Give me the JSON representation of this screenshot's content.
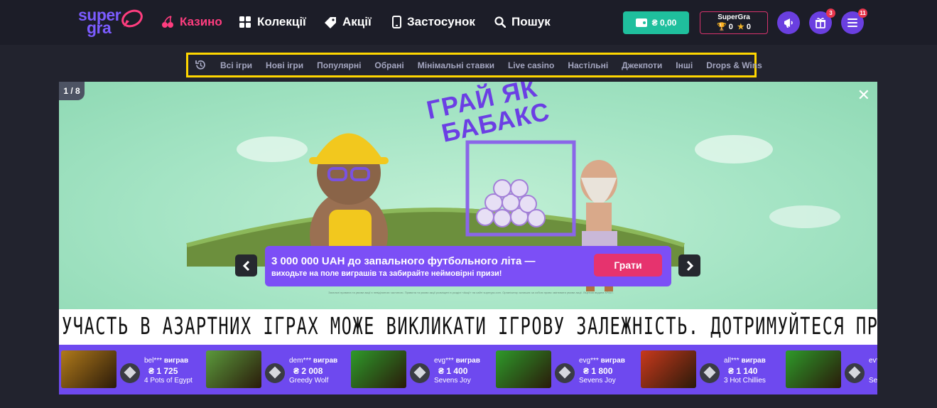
{
  "logo": {
    "line1": "super",
    "line2": "gra"
  },
  "nav": [
    {
      "label": "Казино",
      "icon": "cherries-icon",
      "active": true
    },
    {
      "label": "Колекції",
      "icon": "grid-icon"
    },
    {
      "label": "Акції",
      "icon": "tag-icon"
    },
    {
      "label": "Застосунок",
      "icon": "phone-icon"
    },
    {
      "label": "Пошук",
      "icon": "search-icon"
    }
  ],
  "wallet": {
    "balance": "₴ 0,00",
    "icon": "wallet-icon"
  },
  "supergra": {
    "title": "SuperGra",
    "trophies": "0",
    "stars": "0"
  },
  "header_buttons": [
    {
      "name": "announcements-button",
      "icon": "megaphone-icon",
      "badge": ""
    },
    {
      "name": "gifts-button",
      "icon": "gift-icon",
      "badge": "3"
    },
    {
      "name": "menu-button",
      "icon": "hamburger-icon",
      "badge": "11"
    }
  ],
  "categories": [
    "Всі ігри",
    "Нові ігри",
    "Популярні",
    "Обрані",
    "Мінімальні ставки",
    "Live casino",
    "Настільні",
    "Джекпоти",
    "Інші",
    "Drops & Wins"
  ],
  "banner": {
    "counter": "1 / 8",
    "title_line1": "ГРАЙ ЯК",
    "title_line2": "БАБАКС",
    "headline": "3 000 000 UAH до запального футбольного літа —",
    "subline": "виходьте на поле виграшів та забирайте неймовірні призи!",
    "cta": "Грати",
    "fineprint": "Загальні правила та умови акції є невід'ємною частиною. Правила та умови акції розміщені в розділі «Акції» на сайті supergra.com. Організатор залишає за собою право змінювати умови акції. Ліцензія видана КРАІЛ."
  },
  "warning": "УЧАСТЬ В АЗАРТНИХ ІГРАХ МОЖЕ ВИКЛИКАТИ ІГРОВУ ЗАЛЕЖНІСТЬ. ДОТРИМУЙТЕСЯ ПРАВИЛ (ПРИНЦИПІВ) ВІДПОВІДАЛЬНОЇ ГРИ",
  "winners": [
    {
      "user": "bel***",
      "won": "виграв",
      "amount": "₴ 1 725",
      "game": "4 Pots of Egypt",
      "thumb": "#b07a1a"
    },
    {
      "user": "dem***",
      "won": "виграв",
      "amount": "₴ 2 008",
      "game": "Greedy Wolf",
      "thumb": "#5b9a3c"
    },
    {
      "user": "evg***",
      "won": "виграв",
      "amount": "₴ 1 400",
      "game": "Sevens Joy",
      "thumb": "#2e9a2a"
    },
    {
      "user": "evg***",
      "won": "виграв",
      "amount": "₴ 1 800",
      "game": "Sevens Joy",
      "thumb": "#2e9a2a"
    },
    {
      "user": "all***",
      "won": "виграв",
      "amount": "₴ 1 140",
      "game": "3 Hot Chillies",
      "thumb": "#c8391c"
    },
    {
      "user": "ev***",
      "won": "виграв",
      "amount": "",
      "game": "Se",
      "thumb": "#2e9a2a"
    }
  ],
  "colors": {
    "accent": "#ff3d7f",
    "purple": "#6e49ef",
    "wallet": "#1fbf9d",
    "highlight": "#ffd600"
  }
}
